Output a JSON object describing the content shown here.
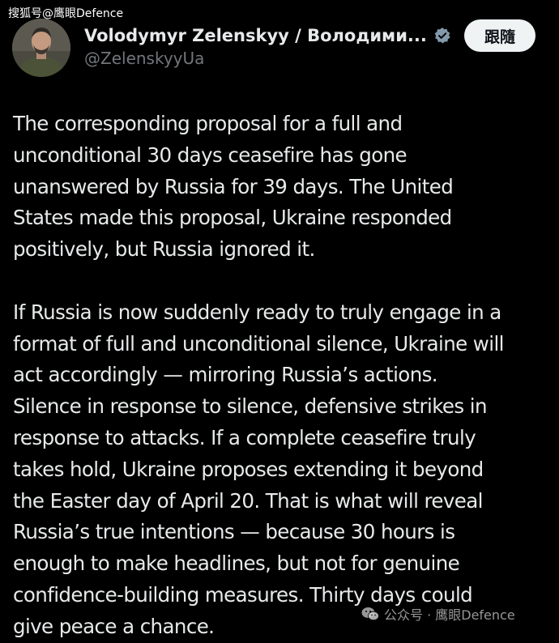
{
  "watermark": {
    "top": "搜狐号@鹰眼Defence",
    "bottom": "公众号 · 鹰眼Defence"
  },
  "author": {
    "display_name": "Volodymyr Zelenskyy / Володими...",
    "handle": "@ZelenskyyUa",
    "verified_icon": "verified-badge-icon"
  },
  "follow_button": {
    "label": "跟隨"
  },
  "tweet": {
    "paragraphs": [
      "The corresponding proposal for a full and\nunconditional 30 days ceasefire has gone\nunanswered by Russia for 39 days. The United\nStates made this proposal, Ukraine responded\npositively, but Russia ignored it.",
      "If Russia is now suddenly ready to truly engage in a\nformat of full and unconditional silence, Ukraine will\nact accordingly — mirroring Russia’s actions.\nSilence in response to silence, defensive strikes in\nresponse to attacks. If a complete ceasefire truly\ntakes hold, Ukraine proposes extending it beyond\nthe Easter day of April 20. That is what will reveal\nRussia’s true intentions — because 30 hours is\nenough to make headlines, but not for genuine\nconfidence-building measures. Thirty days could\ngive peace a chance."
    ]
  },
  "colors": {
    "background": "#000000",
    "text_primary": "#e7e9ea",
    "text_secondary": "#71767b",
    "verified": "#829aab",
    "follow_bg": "#eff3f4"
  }
}
